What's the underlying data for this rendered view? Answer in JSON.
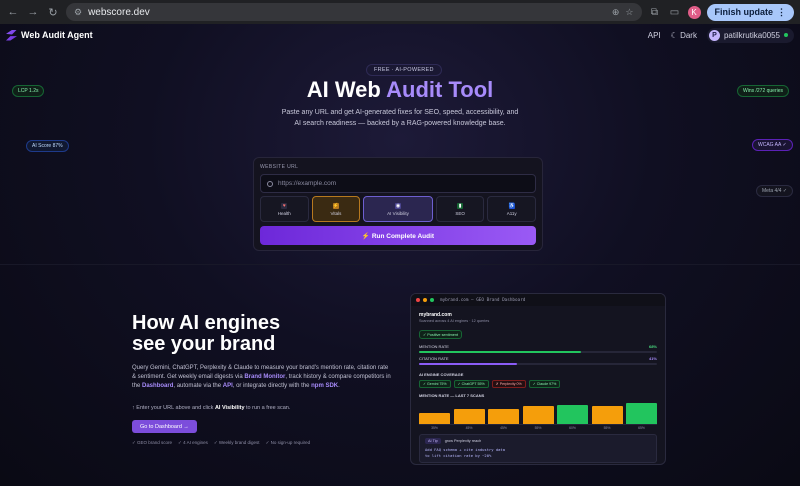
{
  "browser": {
    "url": "webscore.dev",
    "profile_initial": "K",
    "update_label": "Finish update"
  },
  "header": {
    "brand": "Web Audit Agent",
    "api_label": "API",
    "theme_label": "Dark",
    "user_initial": "P",
    "username": "patilkrutika0055"
  },
  "hero": {
    "badge": "FREE · AI-POWERED",
    "title_main": "AI Web ",
    "title_highlight": "Audit Tool",
    "subtitle": "Paste any URL and get AI-generated fixes for SEO, speed, accessibility, and AI search readiness — backed by a RAG-powered knowledge base."
  },
  "floating_badges": {
    "lcp": "LCP 1.2s",
    "ai_score": "AI Score 87%",
    "wcag": "WCAG AA ✓",
    "html": "Wins /272 queries",
    "meta": "Meta 4/4 ✓"
  },
  "audit": {
    "url_label": "WEBSITE URL",
    "url_placeholder": "https://example.com",
    "modes": [
      {
        "label": "Health",
        "icon": "heart"
      },
      {
        "label": "Vitals",
        "icon": "bolt"
      },
      {
        "label": "AI Visibility",
        "icon": "robot"
      },
      {
        "label": "SEO",
        "icon": "chart"
      },
      {
        "label": "A11y",
        "icon": "person"
      }
    ],
    "run_label": "⚡ Run Complete Audit"
  },
  "section": {
    "title_line1": "How AI engines",
    "title_line2": "see your brand",
    "desc_1": "Query Gemini, ChatGPT, Perplexity & Claude to measure your brand's mention rate, citation rate & sentiment. Get weekly email digests via ",
    "desc_brand_monitor": "Brand Monitor",
    "desc_2": ", track history & compare competitors in the ",
    "desc_dashboard": "Dashboard",
    "desc_3": ", automate via the ",
    "desc_api": "API",
    "desc_4": ", or integrate directly with the ",
    "desc_sdk": "npm SDK",
    "desc_5": ".",
    "hint_1": "↑ Enter your URL above and click ",
    "hint_bold": "AI Visibility",
    "hint_2": " to run a free scan.",
    "cta": "Go to Dashboard →",
    "checks": [
      "✓ GEO brand score",
      "✓ 4 AI engines",
      "✓ Weekly brand digest",
      "✓ No sign-up required"
    ]
  },
  "dashboard": {
    "window_title": "mybrand.com — GEO Brand Dashboard",
    "site": "mybrand.com",
    "meta": "Scanned across 4 AI engines · 12 queries",
    "sentiment": "✓ Positive sentiment",
    "mention_label": "MENTION RATE",
    "mention_value": "68%",
    "mention_pct": 68,
    "citation_label": "CITATION RATE",
    "citation_value": "41%",
    "citation_pct": 41,
    "coverage_label": "AI ENGINE COVERAGE",
    "engines": [
      {
        "label": "✓ Gemini 75%",
        "ok": true
      },
      {
        "label": "✓ ChatGPT 55%",
        "ok": true
      },
      {
        "label": "✗ Perplexity 0%",
        "ok": false
      },
      {
        "label": "✓ Claude 97%",
        "ok": true
      }
    ],
    "trend_label": "MENTION RATE — LAST 7 SCANS",
    "tip_tag": "AI Tip",
    "tip_title": "grow Perplexity reach",
    "tip_code_1": "Add FAQ schema + cite industry data",
    "tip_code_2": "to lift citation rate by ~20%"
  },
  "chart_data": {
    "type": "bar",
    "title": "MENTION RATE — LAST 7 SCANS",
    "categories": [
      "1",
      "2",
      "3",
      "4",
      "5",
      "6",
      "7"
    ],
    "values": [
      35,
      45,
      45,
      55,
      60,
      55,
      65
    ],
    "labels": [
      "35%",
      "45%",
      "45%",
      "55%",
      "60%",
      "55%",
      "65%"
    ],
    "colors": [
      "#f59e0b",
      "#f59e0b",
      "#f59e0b",
      "#f59e0b",
      "#22c55e",
      "#f59e0b",
      "#22c55e"
    ],
    "ylim": [
      0,
      100
    ]
  }
}
